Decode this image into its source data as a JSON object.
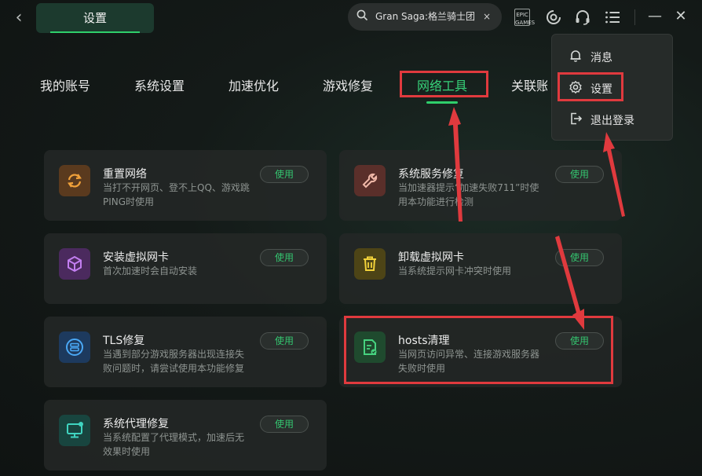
{
  "header": {
    "back_label": "‹",
    "tab_label": "设置",
    "search_value": "Gran Saga:格兰骑士团",
    "search_clear": "×",
    "epic_label": "EPIC GAMES",
    "minimize": "—",
    "close": "✕"
  },
  "nav": [
    "我的账号",
    "系统设置",
    "加速优化",
    "游戏修复",
    "网络工具",
    "关联账号"
  ],
  "cards": [
    {
      "title": "重置网络",
      "desc": "当打不开网页、登不上QQ、游戏跳PING时使用",
      "button": "使用",
      "icon": "refresh-icon",
      "icon_bg": "#5a3a1e",
      "icon_color": "#f0a13a"
    },
    {
      "title": "系统服务修复",
      "desc": "当加速器提示“加速失败711”时使用本功能进行检测",
      "button": "使用",
      "icon": "wrench-icon",
      "icon_bg": "#5a2f2a",
      "icon_color": "#f0b8a8"
    },
    {
      "title": "安装虚拟网卡",
      "desc": "首次加速时会自动安装",
      "button": "使用",
      "icon": "cube-icon",
      "icon_bg": "#4b2a5e",
      "icon_color": "#c27ef0"
    },
    {
      "title": "卸载虚拟网卡",
      "desc": "当系统提示网卡冲突时使用",
      "button": "使用",
      "icon": "trash-icon",
      "icon_bg": "#4d4416",
      "icon_color": "#f2d23a"
    },
    {
      "title": "TLS修复",
      "desc": "当遇到部分游戏服务器出现连接失败问题时，请尝试使用本功能修复",
      "button": "使用",
      "icon": "server-icon",
      "icon_bg": "#1d3a5e",
      "icon_color": "#4aa8f5"
    },
    {
      "title": "hosts清理",
      "desc": "当网页访问异常、连接游戏服务器失败时使用",
      "button": "使用",
      "icon": "file-clean-icon",
      "icon_bg": "#1f4a2e",
      "icon_color": "#46d27f"
    },
    {
      "title": "系统代理修复",
      "desc": "当系统配置了代理模式，加速后无效果时使用",
      "button": "使用",
      "icon": "monitor-icon",
      "icon_bg": "#18453f",
      "icon_color": "#3fd4c0"
    }
  ],
  "menu": [
    {
      "label": "消息",
      "icon": "bell-icon"
    },
    {
      "label": "设置",
      "icon": "gear-icon"
    },
    {
      "label": "退出登录",
      "icon": "logout-icon"
    }
  ],
  "colors": {
    "accent": "#2fcf6b",
    "annotation": "#e03a3e"
  }
}
